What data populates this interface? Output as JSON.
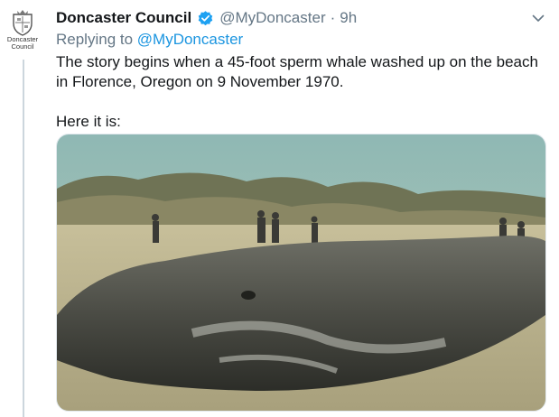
{
  "tweet": {
    "author": {
      "display_name": "Doncaster Council",
      "verified": true,
      "handle": "@MyDoncaster",
      "avatar_text_line1": "Doncaster",
      "avatar_text_line2": "Council"
    },
    "separator": "·",
    "time": "9h",
    "reply": {
      "prefix": "Replying to ",
      "handle": "@MyDoncaster"
    },
    "text_paragraph_1": "The story begins when a 45-foot sperm whale washed up on the beach in Florence, Oregon on 9 November 1970.",
    "text_paragraph_2": "Here it is:",
    "media": {
      "icon": "photo"
    }
  },
  "colors": {
    "text": "#14171a",
    "muted": "#657786",
    "link": "#1b95e0",
    "verified": "#1da1f2",
    "thread_line": "#ccd6dd"
  }
}
